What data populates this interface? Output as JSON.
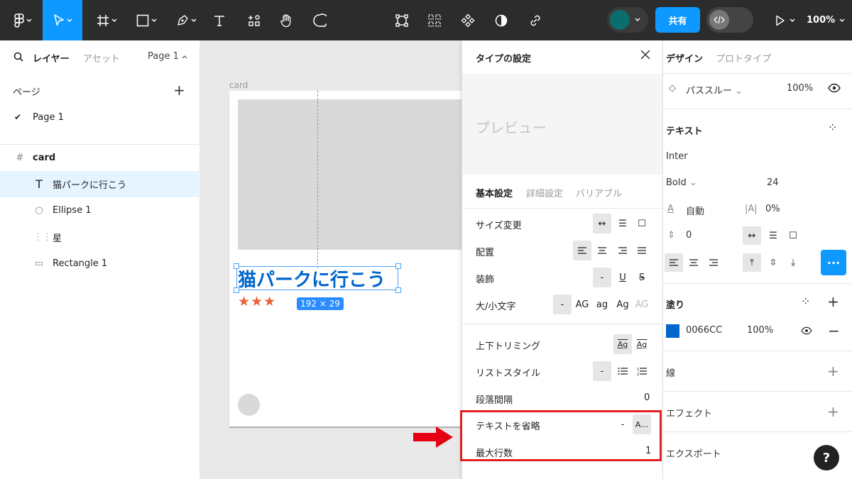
{
  "toolbar": {
    "share_label": "共有",
    "zoom": "100%",
    "avatar_color": "#0B6E6E",
    "active_tool": "move-tool"
  },
  "left_panel": {
    "tab_layers": "レイヤー",
    "tab_assets": "アセット",
    "page_selector": "Page 1",
    "pages_heading": "ページ",
    "pages": [
      {
        "label": "Page 1",
        "checked": true
      }
    ],
    "layers": [
      {
        "label": "card",
        "icon": "frame-icon"
      },
      {
        "label": "猫パークに行こう",
        "icon": "text-icon",
        "selected": true
      },
      {
        "label": "Ellipse 1",
        "icon": "ellipse-icon"
      },
      {
        "label": "星",
        "icon": "star-group-icon"
      },
      {
        "label": "Rectangle 1",
        "icon": "rectangle-icon"
      }
    ]
  },
  "canvas": {
    "frame_label": "card",
    "title_text": "猫パークに行こう",
    "stars": "★★★",
    "dimension_badge": "192 × 29",
    "title_color": "#0066CC",
    "star_color": "#E8623A"
  },
  "type_settings": {
    "title": "タイプの設定",
    "preview": "プレビュー",
    "tabs": [
      "基本設定",
      "詳細設定",
      "バリアブル"
    ],
    "rows": {
      "resize": "サイズ変更",
      "align": "配置",
      "decoration": "装飾",
      "case": "大/小文字",
      "trim": "上下トリミング",
      "list_style": "リストスタイル",
      "paragraph_spacing": "段落間隔",
      "truncate": "テキストを省略",
      "max_lines": "最大行数"
    },
    "values": {
      "decoration_none": "-",
      "case_none": "-",
      "case_upper": "AG",
      "case_lower": "ag",
      "case_title": "Ag",
      "case_small": "AG",
      "trim_on": "Ag",
      "trim_off": "Ag",
      "list_none": "-",
      "paragraph_spacing": "0",
      "truncate_none": "-",
      "truncate_ellipsis": "A…",
      "max_lines": "1"
    }
  },
  "right_panel": {
    "tab_design": "デザイン",
    "tab_prototype": "プロトタイプ",
    "blend_mode": "パススルー",
    "opacity": "100%",
    "text_heading": "テキスト",
    "font_family": "Inter",
    "font_weight": "Bold",
    "font_size": "24",
    "line_height": "自動",
    "letter_spacing": "0%",
    "paragraph_spacing": "0",
    "fill_heading": "塗り",
    "fill_hex": "0066CC",
    "fill_opacity": "100%",
    "fill_color": "#0066CC",
    "stroke_heading": "線",
    "effects_heading": "エフェクト",
    "export_heading": "エクスポート",
    "help": "?"
  }
}
